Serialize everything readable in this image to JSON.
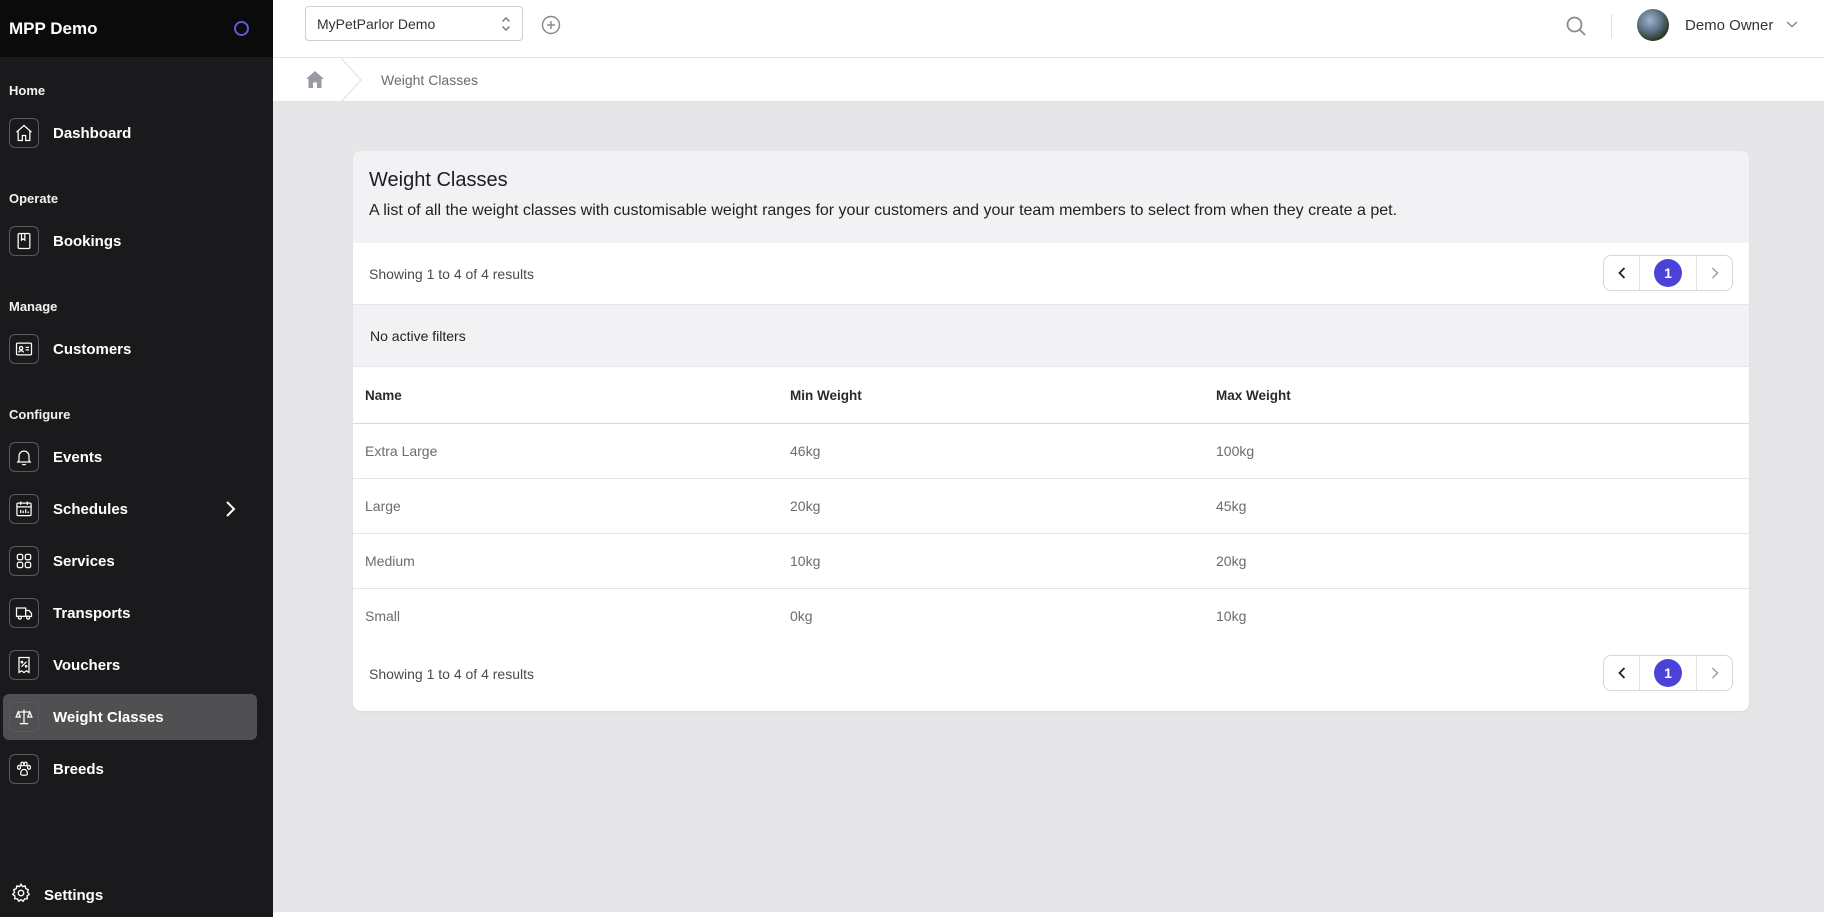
{
  "sidebar": {
    "brand": "MPP Demo",
    "sections": {
      "home": "Home",
      "operate": "Operate",
      "manage": "Manage",
      "configure": "Configure"
    },
    "items": {
      "dashboard": "Dashboard",
      "bookings": "Bookings",
      "customers": "Customers",
      "events": "Events",
      "schedules": "Schedules",
      "services": "Services",
      "transports": "Transports",
      "vouchers": "Vouchers",
      "weight_classes": "Weight Classes",
      "breeds": "Breeds"
    },
    "settings": "Settings",
    "active_item": "Weight Classes",
    "accent_color": "#5b5ce2"
  },
  "topbar": {
    "organization": "MyPetParlor Demo",
    "user_name": "Demo Owner"
  },
  "breadcrumb": {
    "current": "Weight Classes"
  },
  "page": {
    "title": "Weight Classes",
    "description": "A list of all the weight classes with customisable weight ranges for your customers and your team members to select from when they create a pet.",
    "results_text": "Showing 1 to 4 of 4 results",
    "filters_text": "No active filters",
    "current_page": "1",
    "pager_color": "#4b42d6"
  },
  "table": {
    "columns": [
      "Name",
      "Min Weight",
      "Max Weight"
    ],
    "rows": [
      [
        "Extra Large",
        "46kg",
        "100kg"
      ],
      [
        "Large",
        "20kg",
        "45kg"
      ],
      [
        "Medium",
        "10kg",
        "20kg"
      ],
      [
        "Small",
        "0kg",
        "10kg"
      ]
    ]
  }
}
